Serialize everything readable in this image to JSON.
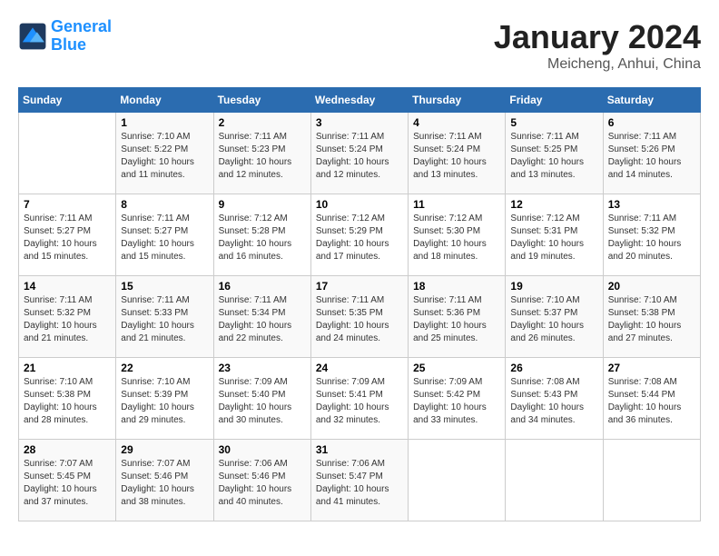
{
  "logo": {
    "line1": "General",
    "line2": "Blue"
  },
  "title": {
    "month": "January 2024",
    "location": "Meicheng, Anhui, China"
  },
  "headers": [
    "Sunday",
    "Monday",
    "Tuesday",
    "Wednesday",
    "Thursday",
    "Friday",
    "Saturday"
  ],
  "weeks": [
    [
      {
        "day": "",
        "sunrise": "",
        "sunset": "",
        "daylight": ""
      },
      {
        "day": "1",
        "sunrise": "7:10 AM",
        "sunset": "5:22 PM",
        "daylight": "10 hours and 11 minutes."
      },
      {
        "day": "2",
        "sunrise": "7:11 AM",
        "sunset": "5:23 PM",
        "daylight": "10 hours and 12 minutes."
      },
      {
        "day": "3",
        "sunrise": "7:11 AM",
        "sunset": "5:24 PM",
        "daylight": "10 hours and 12 minutes."
      },
      {
        "day": "4",
        "sunrise": "7:11 AM",
        "sunset": "5:24 PM",
        "daylight": "10 hours and 13 minutes."
      },
      {
        "day": "5",
        "sunrise": "7:11 AM",
        "sunset": "5:25 PM",
        "daylight": "10 hours and 13 minutes."
      },
      {
        "day": "6",
        "sunrise": "7:11 AM",
        "sunset": "5:26 PM",
        "daylight": "10 hours and 14 minutes."
      }
    ],
    [
      {
        "day": "7",
        "sunrise": "7:11 AM",
        "sunset": "5:27 PM",
        "daylight": "10 hours and 15 minutes."
      },
      {
        "day": "8",
        "sunrise": "7:11 AM",
        "sunset": "5:27 PM",
        "daylight": "10 hours and 15 minutes."
      },
      {
        "day": "9",
        "sunrise": "7:12 AM",
        "sunset": "5:28 PM",
        "daylight": "10 hours and 16 minutes."
      },
      {
        "day": "10",
        "sunrise": "7:12 AM",
        "sunset": "5:29 PM",
        "daylight": "10 hours and 17 minutes."
      },
      {
        "day": "11",
        "sunrise": "7:12 AM",
        "sunset": "5:30 PM",
        "daylight": "10 hours and 18 minutes."
      },
      {
        "day": "12",
        "sunrise": "7:12 AM",
        "sunset": "5:31 PM",
        "daylight": "10 hours and 19 minutes."
      },
      {
        "day": "13",
        "sunrise": "7:11 AM",
        "sunset": "5:32 PM",
        "daylight": "10 hours and 20 minutes."
      }
    ],
    [
      {
        "day": "14",
        "sunrise": "7:11 AM",
        "sunset": "5:32 PM",
        "daylight": "10 hours and 21 minutes."
      },
      {
        "day": "15",
        "sunrise": "7:11 AM",
        "sunset": "5:33 PM",
        "daylight": "10 hours and 21 minutes."
      },
      {
        "day": "16",
        "sunrise": "7:11 AM",
        "sunset": "5:34 PM",
        "daylight": "10 hours and 22 minutes."
      },
      {
        "day": "17",
        "sunrise": "7:11 AM",
        "sunset": "5:35 PM",
        "daylight": "10 hours and 24 minutes."
      },
      {
        "day": "18",
        "sunrise": "7:11 AM",
        "sunset": "5:36 PM",
        "daylight": "10 hours and 25 minutes."
      },
      {
        "day": "19",
        "sunrise": "7:10 AM",
        "sunset": "5:37 PM",
        "daylight": "10 hours and 26 minutes."
      },
      {
        "day": "20",
        "sunrise": "7:10 AM",
        "sunset": "5:38 PM",
        "daylight": "10 hours and 27 minutes."
      }
    ],
    [
      {
        "day": "21",
        "sunrise": "7:10 AM",
        "sunset": "5:38 PM",
        "daylight": "10 hours and 28 minutes."
      },
      {
        "day": "22",
        "sunrise": "7:10 AM",
        "sunset": "5:39 PM",
        "daylight": "10 hours and 29 minutes."
      },
      {
        "day": "23",
        "sunrise": "7:09 AM",
        "sunset": "5:40 PM",
        "daylight": "10 hours and 30 minutes."
      },
      {
        "day": "24",
        "sunrise": "7:09 AM",
        "sunset": "5:41 PM",
        "daylight": "10 hours and 32 minutes."
      },
      {
        "day": "25",
        "sunrise": "7:09 AM",
        "sunset": "5:42 PM",
        "daylight": "10 hours and 33 minutes."
      },
      {
        "day": "26",
        "sunrise": "7:08 AM",
        "sunset": "5:43 PM",
        "daylight": "10 hours and 34 minutes."
      },
      {
        "day": "27",
        "sunrise": "7:08 AM",
        "sunset": "5:44 PM",
        "daylight": "10 hours and 36 minutes."
      }
    ],
    [
      {
        "day": "28",
        "sunrise": "7:07 AM",
        "sunset": "5:45 PM",
        "daylight": "10 hours and 37 minutes."
      },
      {
        "day": "29",
        "sunrise": "7:07 AM",
        "sunset": "5:46 PM",
        "daylight": "10 hours and 38 minutes."
      },
      {
        "day": "30",
        "sunrise": "7:06 AM",
        "sunset": "5:46 PM",
        "daylight": "10 hours and 40 minutes."
      },
      {
        "day": "31",
        "sunrise": "7:06 AM",
        "sunset": "5:47 PM",
        "daylight": "10 hours and 41 minutes."
      },
      {
        "day": "",
        "sunrise": "",
        "sunset": "",
        "daylight": ""
      },
      {
        "day": "",
        "sunrise": "",
        "sunset": "",
        "daylight": ""
      },
      {
        "day": "",
        "sunrise": "",
        "sunset": "",
        "daylight": ""
      }
    ]
  ]
}
